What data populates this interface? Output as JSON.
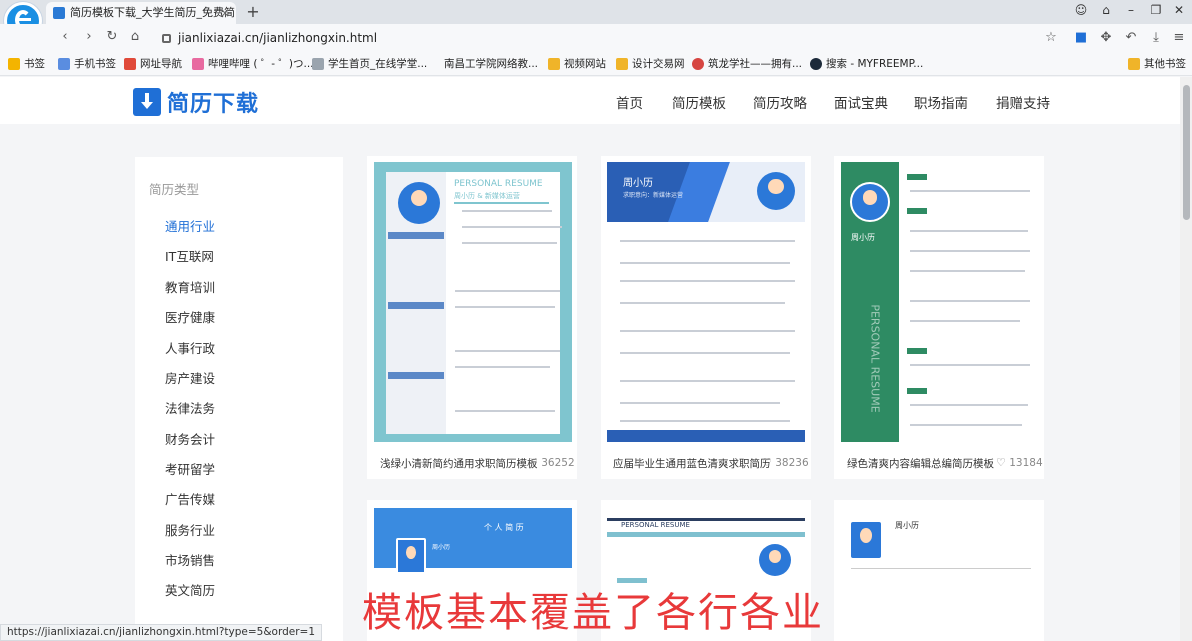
{
  "browser": {
    "tab_title": "简历模板下载_大学生简历_免费简",
    "tab_close": "×",
    "new_tab": "+",
    "url": "jianlixiazai.cn/jianlizhongxin.html",
    "status_url": "https://jianlixiazai.cn/jianlizhongxin.html?type=5&order=1",
    "bookmarks": [
      "书签",
      "手机书签",
      "网址导航",
      "哔哩哔哩 ( ゜- ゜)つ...",
      "学生首页_在线学堂...",
      "南昌工学院网络教...",
      "视频网站",
      "设计交易网",
      "筑龙学社——拥有...",
      "搜索 - MYFREEMP...",
      "其他书签"
    ]
  },
  "site": {
    "logo_text": "简历下载",
    "nav": [
      "首页",
      "简历模板",
      "简历攻略",
      "面试宝典",
      "职场指南",
      "捐赠支持"
    ]
  },
  "sidebar": {
    "title": "简历类型",
    "items": [
      "通用行业",
      "IT互联网",
      "教育培训",
      "医疗健康",
      "人事行政",
      "房产建设",
      "法律法务",
      "财务会计",
      "考研留学",
      "广告传媒",
      "服务行业",
      "市场销售",
      "英文简历"
    ],
    "active_index": 0
  },
  "cards": [
    {
      "title": "浅绿小清新简约通用求职简历模板",
      "likes": "36252",
      "resume_heading": "PERSONAL RESUME",
      "resume_name": "周小历 & 新媒体运营"
    },
    {
      "title": "应届毕业生通用蓝色清爽求职简历",
      "likes": "38236",
      "resume_name": "周小历",
      "resume_subtitle": "求职意向：新媒体运营"
    },
    {
      "title": "绿色清爽内容编辑总编简历模板",
      "likes": "13184",
      "resume_name": "周小历",
      "resume_vertical": "PERSONAL RESUME"
    },
    {
      "title": "",
      "likes": "",
      "resume_heading": "个 人 简 历",
      "resume_name": "周小历"
    },
    {
      "title": "",
      "likes": "",
      "resume_heading": "PERSONAL RESUME"
    },
    {
      "title": "",
      "likes": "",
      "resume_name": "周小历"
    }
  ],
  "caption": "模板基本覆盖了各行各业",
  "colors": {
    "brand_blue": "#1f6fd6",
    "caption_red": "#e8393a",
    "teal": "#6ec3cf",
    "green": "#2e8b63"
  }
}
